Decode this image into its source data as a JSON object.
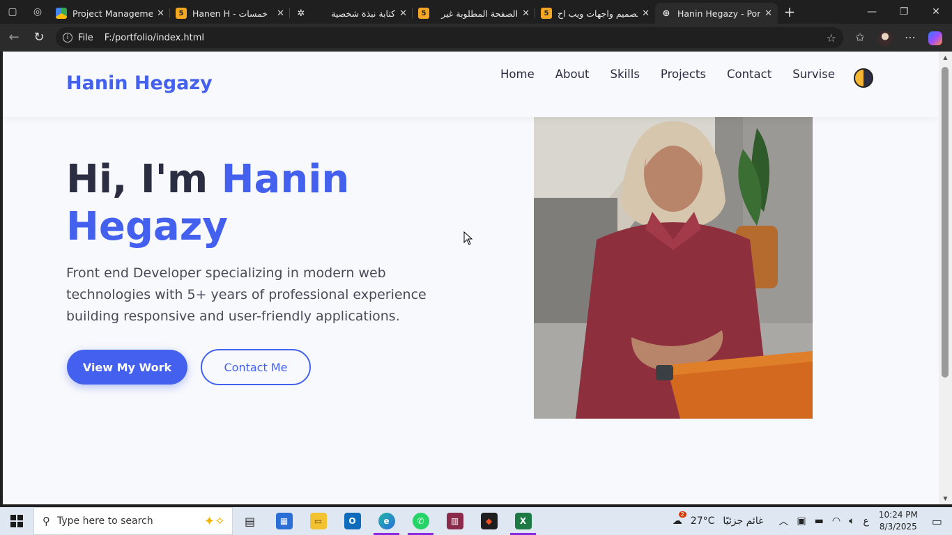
{
  "browser": {
    "tabs": [
      {
        "title": "Project Management",
        "favicon": "google-drive-icon"
      },
      {
        "title": "Hanen H - خمسات",
        "favicon": "khamsat-icon"
      },
      {
        "title": "كتابة نبذة شخصية",
        "favicon": "chatgpt-icon"
      },
      {
        "title": "الصفحة المطلوبة غير",
        "favicon": "khamsat-icon"
      },
      {
        "title": "تصميم واجهات ويب اح",
        "favicon": "khamsat-icon"
      },
      {
        "title": "Hanin Hegazy - Portfo",
        "favicon": "globe-icon"
      }
    ],
    "address": {
      "scheme_label": "File",
      "url": "F:/portfolio/index.html"
    }
  },
  "site": {
    "logo": "Hanin Hegazy",
    "nav": [
      "Home",
      "About",
      "Skills",
      "Projects",
      "Contact",
      "Survise"
    ],
    "hero": {
      "greeting": "Hi, I'm ",
      "name_line1": "Hanin",
      "name_line2": "Hegazy",
      "description": "Front end Developer specializing in modern web technologies with 5+ years of professional experience building responsive and user-friendly applications.",
      "primary_button": "View My Work",
      "secondary_button": "Contact Me"
    },
    "accent_color": "#4361ee"
  },
  "taskbar": {
    "search_placeholder": "Type here to search",
    "weather": {
      "temp": "27°C",
      "desc": "غائم جزئيًا",
      "badge": "2"
    },
    "lang": "ع",
    "time": "10:24 PM",
    "date": "8/3/2025"
  }
}
